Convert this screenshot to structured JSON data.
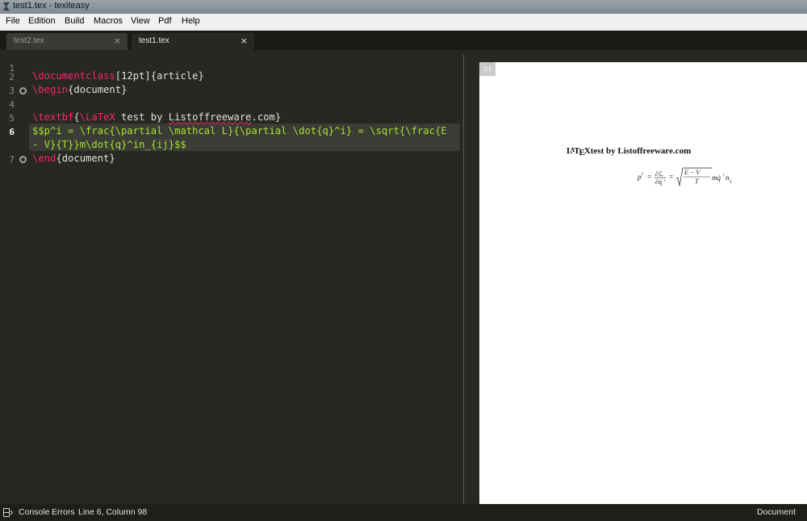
{
  "window": {
    "title": "test1.tex - texiteasy"
  },
  "menu": [
    "File",
    "Edition",
    "Build",
    "Macros",
    "View",
    "Pdf",
    "Help"
  ],
  "tabs": [
    {
      "label": "test2.tex",
      "close": "×",
      "active": false
    },
    {
      "label": "test1.tex",
      "close": "×",
      "active": true
    }
  ],
  "editor": {
    "line_numbers": [
      "1",
      "2",
      "3",
      "4",
      "5",
      "6",
      "7"
    ],
    "current_line": "6",
    "lines": {
      "l2_cmd": "\\documentclass",
      "l2_rest": "[12pt]{article}",
      "l3_cmd": "\\begin",
      "l3_rest": "{document}",
      "l5_cmd": "\\textbf",
      "l5_open": "{",
      "l5_latex": "\\LaTeX",
      "l5_rest_a": " test by ",
      "l5_squiggle": "Listoffreeware",
      "l5_rest_b": ".com}",
      "l6a": "$$p^i = \\frac{\\partial \\mathcal L}{\\partial \\dot{q}^i} = \\sqrt{\\frac{E",
      "l6b": "- V}{T}}m\\dot{q}^in_{ij}$$",
      "l7_cmd": "\\end",
      "l7_rest": "{document}"
    }
  },
  "preview": {
    "page_badge": "1/1",
    "heading_logo_l": "L",
    "heading_logo_a": "A",
    "heading_logo_t": "T",
    "heading_logo_e": "E",
    "heading_logo_x": "X",
    "heading_rest": "test by Listoffreeware.com",
    "formula": {
      "p": "p",
      "p_sup": "i",
      "eq1": "=",
      "frac_num": "∂ℒ",
      "frac_den": "∂q̇",
      "frac_den_sup": "i",
      "eq2": "=",
      "sqrt_num": "E − V",
      "sqrt_den": "T",
      "tail": "mq̇",
      "tail_sup": "i",
      "tail_n": "n",
      "tail_sub": "ij"
    }
  },
  "status": {
    "console": "Console",
    "errors": "Errors",
    "position": "Line 6, Column 98",
    "mode": "Document"
  },
  "colors": {
    "editor_bg": "#272822",
    "keyword": "#f92672",
    "math": "#a6e22e",
    "text": "#f8f8f2"
  }
}
